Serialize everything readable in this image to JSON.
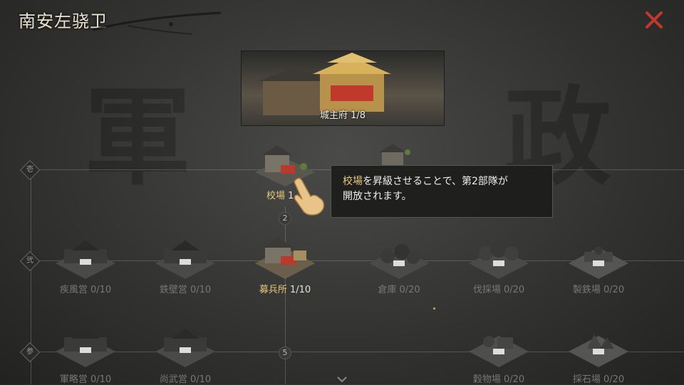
{
  "header": {
    "title": "南安左骁卫",
    "close_icon": "close-icon"
  },
  "background": {
    "left_glyph": "軍",
    "right_glyph": "政"
  },
  "hero": {
    "label": "城主府 1/8"
  },
  "rows": [
    {
      "mark": "壱"
    },
    {
      "mark": "弐"
    },
    {
      "mark": "参"
    }
  ],
  "connectors": {
    "num_2": "2",
    "num_5": "5"
  },
  "buildings": {
    "kouba": {
      "name": "校場",
      "level": "1",
      "state": "active"
    },
    "row2": [
      {
        "name": "疾風営",
        "level": "0/10",
        "state": "locked"
      },
      {
        "name": "鉄壁営",
        "level": "0/10",
        "state": "locked"
      },
      {
        "name": "募兵所",
        "level": "1/10",
        "state": "active"
      },
      {
        "name": "倉庫",
        "level": "0/20",
        "state": "locked"
      },
      {
        "name": "伐採場",
        "level": "0/20",
        "state": "locked"
      },
      {
        "name": "製鉄場",
        "level": "0/20",
        "state": "locked"
      }
    ],
    "row3": [
      {
        "name": "軍略営",
        "level": "0/10",
        "state": "locked"
      },
      {
        "name": "尚武営",
        "level": "0/10",
        "state": "locked"
      },
      {
        "name": "穀物場",
        "level": "0/20",
        "state": "locked"
      },
      {
        "name": "採石場",
        "level": "0/20",
        "state": "locked"
      }
    ]
  },
  "tooltip": {
    "highlight": "校場",
    "text_line1_rest": "を昇級させることで、第2部隊が",
    "text_line2": "開放されます。"
  },
  "colors": {
    "accent": "#e6c879",
    "close": "#c0392b",
    "locked_label": "#777777"
  }
}
